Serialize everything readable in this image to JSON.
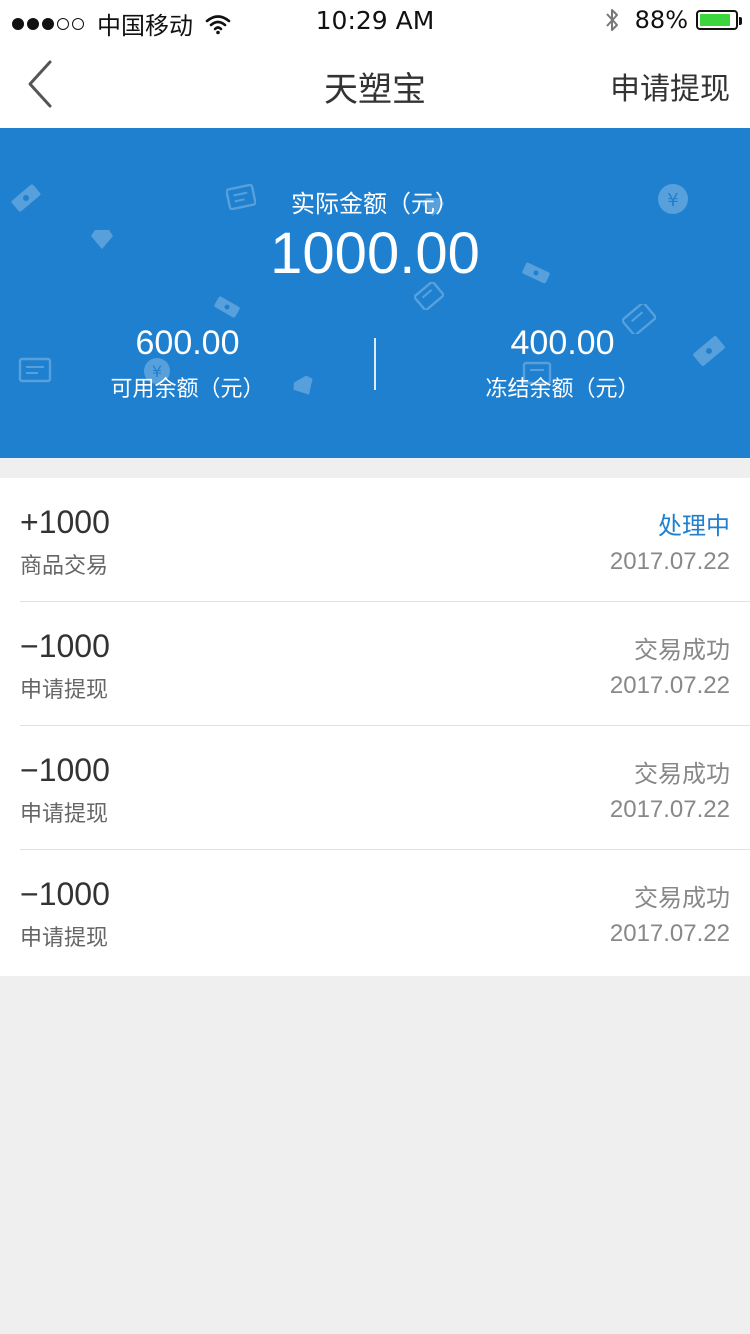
{
  "status_bar": {
    "carrier": "中国移动",
    "time": "10:29 AM",
    "battery_percent_text": "88%",
    "battery_level": 0.88,
    "icons": [
      "signal-dots",
      "wifi-icon",
      "bluetooth-icon",
      "battery-icon"
    ]
  },
  "nav": {
    "back_icon": "chevron-left-icon",
    "title": "天塑宝",
    "action_label": "申请提现"
  },
  "balance": {
    "total_label": "实际金额（元）",
    "total_value": "1000.00",
    "available_value": "600.00",
    "available_label": "可用余额（元）",
    "frozen_value": "400.00",
    "frozen_label": "冻结余额（元）"
  },
  "records": [
    {
      "amount": "+1000",
      "type": "商品交易",
      "status": "处理中",
      "date": "2017.07.22"
    },
    {
      "amount": "−1000",
      "type": "申请提现",
      "status": "交易成功",
      "date": "2017.07.22"
    },
    {
      "amount": "−1000",
      "type": "申请提现",
      "status": "交易成功",
      "date": "2017.07.22"
    },
    {
      "amount": "−1000",
      "type": "申请提现",
      "status": "交易成功",
      "date": "2017.07.22"
    }
  ],
  "colors": {
    "brand_blue": "#1f80d0",
    "processing": "#1f80d0",
    "battery_green": "#3cd63c",
    "page_bg": "#efefef"
  }
}
